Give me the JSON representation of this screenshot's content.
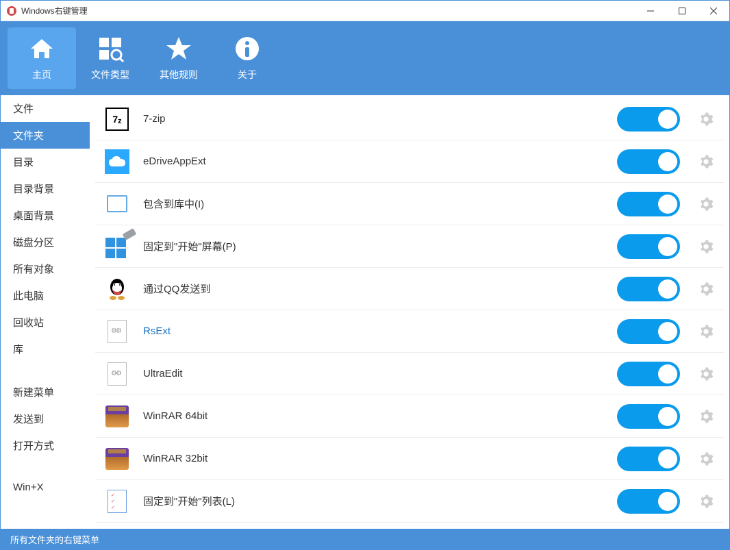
{
  "titlebar": {
    "title": "Windows右键管理"
  },
  "topnav": {
    "items": [
      {
        "label": "主页",
        "active": true
      },
      {
        "label": "文件类型",
        "active": false
      },
      {
        "label": "其他规则",
        "active": false
      },
      {
        "label": "关于",
        "active": false
      }
    ]
  },
  "sidebar": {
    "groups": [
      {
        "items": [
          {
            "label": "文件",
            "active": false
          },
          {
            "label": "文件夹",
            "active": true
          },
          {
            "label": "目录",
            "active": false
          },
          {
            "label": "目录背景",
            "active": false
          },
          {
            "label": "桌面背景",
            "active": false
          },
          {
            "label": "磁盘分区",
            "active": false
          },
          {
            "label": "所有对象",
            "active": false
          },
          {
            "label": "此电脑",
            "active": false
          },
          {
            "label": "回收站",
            "active": false
          },
          {
            "label": "库",
            "active": false
          }
        ]
      },
      {
        "items": [
          {
            "label": "新建菜单",
            "active": false
          },
          {
            "label": "发送到",
            "active": false
          },
          {
            "label": "打开方式",
            "active": false
          }
        ]
      },
      {
        "items": [
          {
            "label": "Win+X",
            "active": false
          }
        ]
      }
    ]
  },
  "list": {
    "items": [
      {
        "icon": "7z",
        "label": "7-zip",
        "enabled": true,
        "highlight": false
      },
      {
        "icon": "cloud",
        "label": "eDriveAppExt",
        "enabled": true,
        "highlight": false
      },
      {
        "icon": "library",
        "label": "包含到库中(I)",
        "enabled": true,
        "highlight": false
      },
      {
        "icon": "pin-tiles",
        "label": "固定到\"开始\"屏幕(P)",
        "enabled": true,
        "highlight": false
      },
      {
        "icon": "qq",
        "label": "通过QQ发送到",
        "enabled": true,
        "highlight": false
      },
      {
        "icon": "dll",
        "label": "RsExt",
        "enabled": true,
        "highlight": true
      },
      {
        "icon": "dll",
        "label": "UltraEdit",
        "enabled": true,
        "highlight": false
      },
      {
        "icon": "rar",
        "label": "WinRAR 64bit",
        "enabled": true,
        "highlight": false
      },
      {
        "icon": "rar",
        "label": "WinRAR 32bit",
        "enabled": true,
        "highlight": false
      },
      {
        "icon": "list",
        "label": "固定到\"开始\"列表(L)",
        "enabled": true,
        "highlight": false
      }
    ]
  },
  "statusbar": {
    "text": "所有文件夹的右键菜单"
  }
}
